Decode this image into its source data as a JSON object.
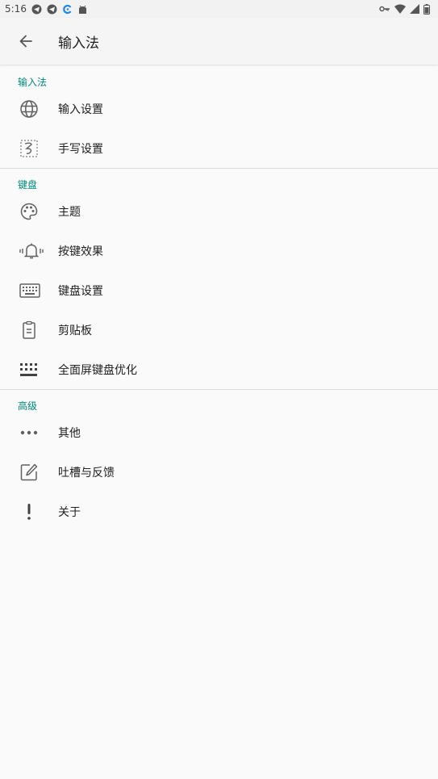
{
  "status_bar": {
    "time": "5:16"
  },
  "app_bar": {
    "title": "输入法"
  },
  "sections": [
    {
      "title": "输入法",
      "items": [
        {
          "label": "输入设置",
          "icon": "globe-icon"
        },
        {
          "label": "手写设置",
          "icon": "handwriting-icon"
        }
      ]
    },
    {
      "title": "键盘",
      "items": [
        {
          "label": "主题",
          "icon": "palette-icon"
        },
        {
          "label": "按键效果",
          "icon": "vibrate-bell-icon"
        },
        {
          "label": "键盘设置",
          "icon": "keyboard-icon"
        },
        {
          "label": "剪贴板",
          "icon": "clipboard-icon"
        },
        {
          "label": "全面屏键盘优化",
          "icon": "dots-grid-icon"
        }
      ]
    },
    {
      "title": "高级",
      "items": [
        {
          "label": "其他",
          "icon": "more-dots-icon"
        },
        {
          "label": "吐槽与反馈",
          "icon": "edit-icon"
        },
        {
          "label": "关于",
          "icon": "exclamation-icon"
        }
      ]
    }
  ],
  "colors": {
    "accent": "#00897b",
    "icon": "#616161",
    "background": "#fafafa"
  }
}
